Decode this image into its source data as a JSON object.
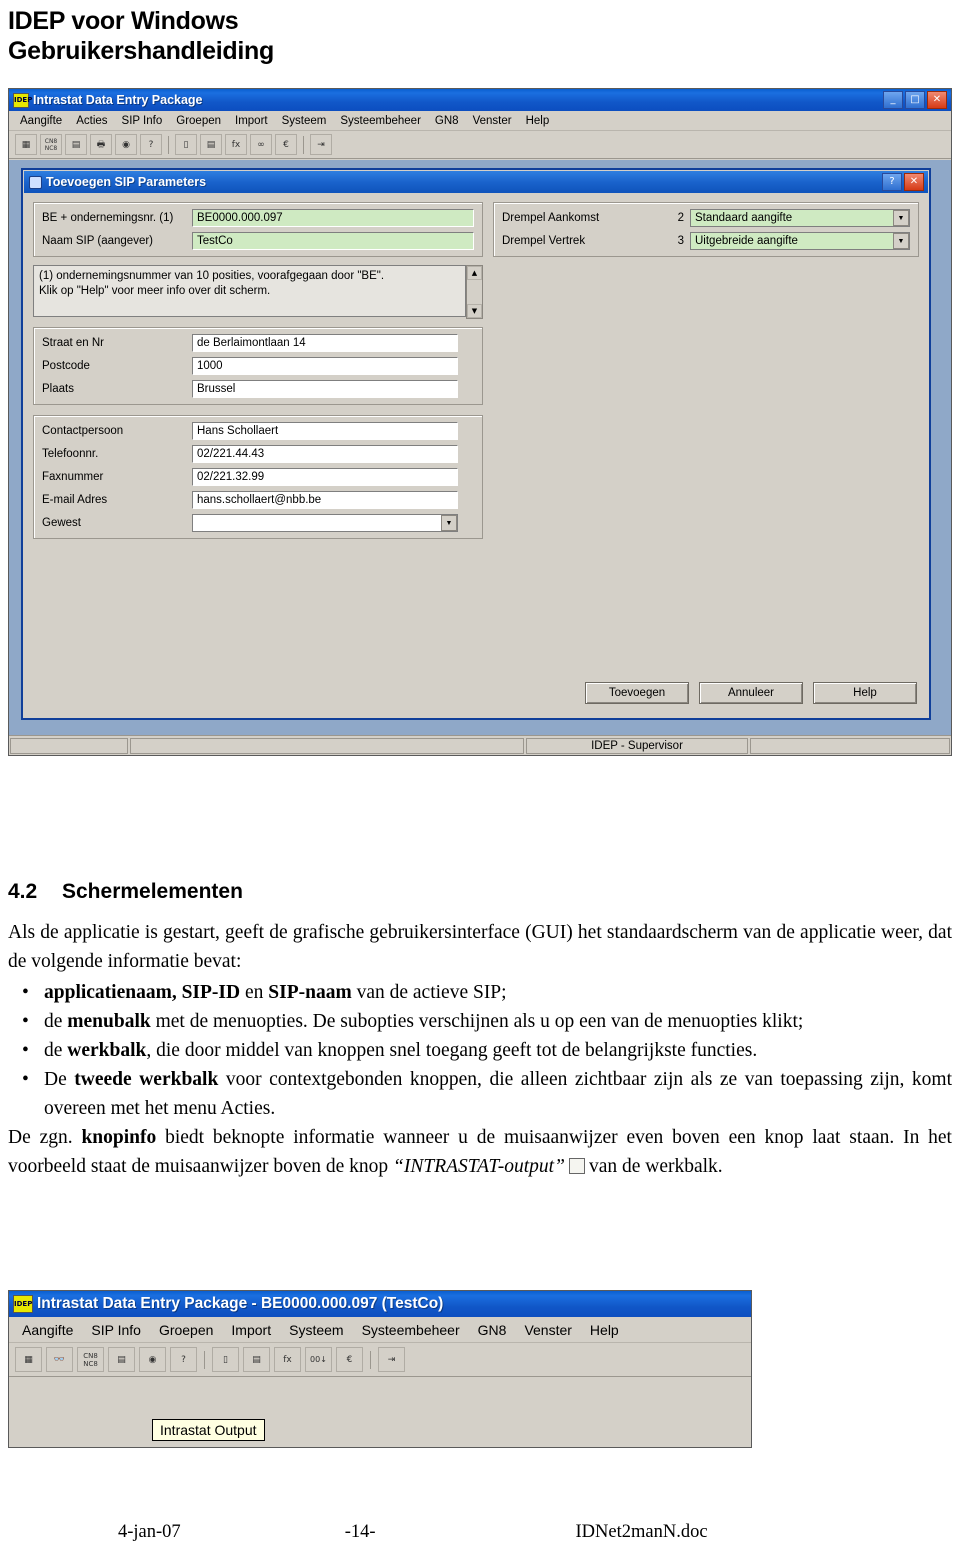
{
  "header": {
    "line1": "IDEP voor Windows",
    "line2": "Gebruikershandleiding"
  },
  "screenshot1": {
    "title": "Intrastat Data Entry Package",
    "logo_text": "IDEP",
    "window_buttons": {
      "minimize": "_",
      "maximize": "□",
      "close": "✕"
    },
    "menu": [
      "Aangifte",
      "Acties",
      "SIP Info",
      "Groepen",
      "Import",
      "Systeem",
      "Systeembeheer",
      "GN8",
      "Venster",
      "Help"
    ],
    "toolbar_icons": [
      "grid-icon",
      "cn8-nc8-icon",
      "print-preview-icon",
      "printer-icon",
      "camera-icon",
      "help-question-icon",
      "copy-icon",
      "paste-icon",
      "fx-icon",
      "chain-icon",
      "euro-icon",
      "export-icon"
    ],
    "dialog": {
      "title": "Toevoegen SIP Parameters",
      "help_button": "?",
      "close_button": "✕",
      "fields": {
        "be_label": "BE + ondernemingsnr. (1)",
        "be_value": "BE0000.000.097",
        "naam_label": "Naam SIP (aangever)",
        "naam_value": "TestCo",
        "drempel_aankomst_label": "Drempel Aankomst",
        "drempel_aankomst_num": "2",
        "drempel_aankomst_value": "Standaard aangifte",
        "drempel_vertrek_label": "Drempel Vertrek",
        "drempel_vertrek_num": "3",
        "drempel_vertrek_value": "Uitgebreide aangifte",
        "note_line1": "(1) ondernemingsnummer van 10 posities, voorafgegaan door \"BE\".",
        "note_line2": "Klik op \"Help\" voor meer info over dit scherm.",
        "straat_label": "Straat en Nr",
        "straat_value": "de Berlaimontlaan 14",
        "postcode_label": "Postcode",
        "postcode_value": "1000",
        "plaats_label": "Plaats",
        "plaats_value": "Brussel",
        "contactpersoon_label": "Contactpersoon",
        "contactpersoon_value": "Hans Schollaert",
        "telefoon_label": "Telefoonnr.",
        "telefoon_value": "02/221.44.43",
        "fax_label": "Faxnummer",
        "fax_value": "02/221.32.99",
        "email_label": "E-mail Adres",
        "email_value": "hans.schollaert@nbb.be",
        "gewest_label": "Gewest",
        "gewest_value": ""
      },
      "buttons": {
        "add": "Toevoegen",
        "cancel": "Annuleer",
        "help": "Help"
      }
    },
    "status": "IDEP - Supervisor"
  },
  "section": {
    "number": "4.2",
    "title": "Schermelementen",
    "intro_1": "Als de applicatie is gestart, geeft de grafische gebruikersinterface (GUI) het standaardscherm",
    "intro_2": "van de applicatie weer, dat de volgende informatie bevat:",
    "bullet1_pre": "",
    "bullet1_bold": "applicatienaam, SIP-ID",
    "bullet1_mid": " en ",
    "bullet1_bold2": "SIP-naam",
    "bullet1_post": " van de actieve SIP;",
    "bullet2_pre": "de ",
    "bullet2_bold": "menubalk",
    "bullet2_post": " met de menuopties. De subopties verschijnen als u op een van de menuopties klikt;",
    "bullet3_pre": "de ",
    "bullet3_bold": "werkbalk",
    "bullet3_post": ", die door middel van knoppen snel toegang geeft tot de belangrijkste functies.",
    "bullet4_pre": "De ",
    "bullet4_bold": "tweede werkbalk",
    "bullet4_post": " voor contextgebonden knoppen, die alleen zichtbaar zijn als ze van toepassing zijn, komt overeen met het menu Acties.",
    "para_pre": "De zgn. ",
    "para_bold": "knopinfo",
    "para_post": " biedt beknopte informatie wanneer u de muisaanwijzer even boven een knop laat staan.  In het voorbeeld staat de muisaanwijzer boven de knop ",
    "para_italic": "“INTRASTAT-output”",
    "para_tail": "van de werkbalk."
  },
  "screenshot2": {
    "logo_text": "IDEP",
    "title": "Intrastat Data Entry Package - BE0000.000.097 (TestCo)",
    "menu": [
      "Aangifte",
      "SIP Info",
      "Groepen",
      "Import",
      "Systeem",
      "Systeembeheer",
      "GN8",
      "Venster",
      "Help"
    ],
    "toolbar_icons": [
      "grid-icon",
      "binoculars-icon",
      "cn8-nc8-icon",
      "print-preview-icon",
      "camera-icon",
      "help-question-icon",
      "copy-icon",
      "calendar-icon",
      "fx-icon",
      "oo-arrow-icon",
      "euro-icon",
      "export-icon"
    ],
    "tooltip": "Intrastat Output"
  },
  "footer": {
    "date": "4-jan-07",
    "page": "-14-",
    "filename": "IDNet2manN.doc"
  }
}
